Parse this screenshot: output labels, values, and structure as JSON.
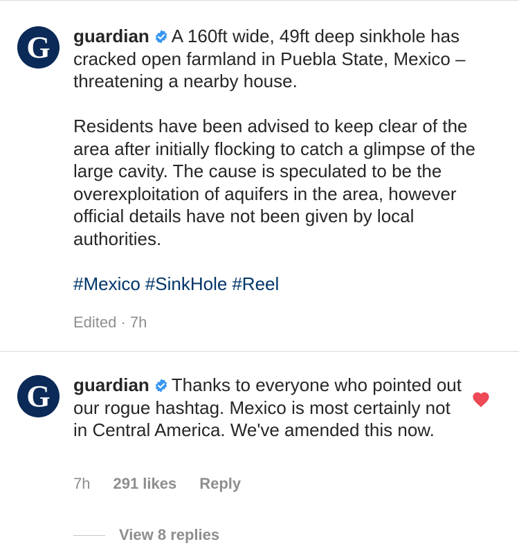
{
  "post": {
    "username": "guardian",
    "avatar_icon": "guardian-g-logo-icon",
    "verified_icon": "verified-badge-icon",
    "caption_lead": "A 160ft wide, 49ft deep sinkhole has cracked open farmland in Puebla State, Mexico – threatening a nearby house.",
    "caption_body": "Residents have been advised to keep clear of the area after initially flocking to catch a glimpse of the large cavity. The cause is speculated to be the overexploitation of aquifers in the area, however official details have not been given by local authorities.",
    "hashtags": [
      "#Mexico",
      "#SinkHole",
      "#Reel"
    ],
    "edited_label": "Edited · 7h"
  },
  "comment": {
    "username": "guardian",
    "text": "Thanks to everyone who pointed out our rogue hashtag. Mexico is most certainly not in Central America. We've amended this now.",
    "time": "7h",
    "likes": "291 likes",
    "reply_label": "Reply",
    "liked": true,
    "like_icon": "heart-icon",
    "view_replies_label": "View 8 replies"
  },
  "colors": {
    "text": "#262626",
    "secondary": "#8e8e8e",
    "hashtag": "#003569",
    "avatar_bg": "#0b2a57",
    "verified": "#3897f0",
    "heart": "#ed4956"
  }
}
